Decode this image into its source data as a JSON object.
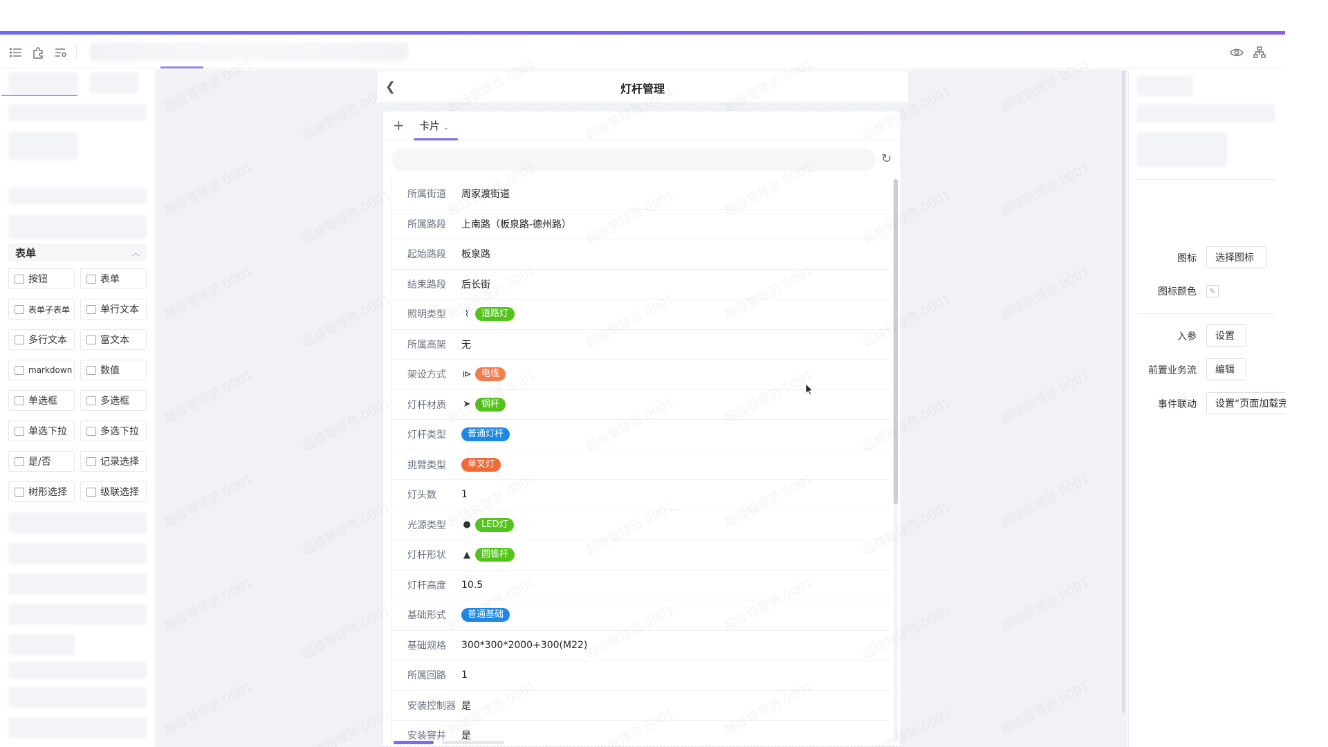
{
  "toolbar": {
    "icons": [
      "list-icon",
      "puzzle-icon",
      "settings-list-icon",
      "eye-icon",
      "sitemap-icon"
    ]
  },
  "left_panel": {
    "form_section_title": "表单",
    "components": [
      {
        "label": "按钮",
        "icon": "button-icon"
      },
      {
        "label": "表单",
        "icon": "form-icon"
      },
      {
        "label": "表单子表单",
        "icon": "subform-icon"
      },
      {
        "label": "单行文本",
        "icon": "text-icon"
      },
      {
        "label": "多行文本",
        "icon": "textarea-icon"
      },
      {
        "label": "富文本",
        "icon": "richtext-icon"
      },
      {
        "label": "markdown",
        "icon": "markdown-icon"
      },
      {
        "label": "数值",
        "icon": "number-icon"
      },
      {
        "label": "单选框",
        "icon": "radio-icon"
      },
      {
        "label": "多选框",
        "icon": "checkbox-icon"
      },
      {
        "label": "单选下拉",
        "icon": "select-icon"
      },
      {
        "label": "多选下拉",
        "icon": "multiselect-icon"
      },
      {
        "label": "是/否",
        "icon": "switch-icon"
      },
      {
        "label": "记录选择",
        "icon": "record-select-icon"
      },
      {
        "label": "树形选择",
        "icon": "tree-select-icon"
      },
      {
        "label": "级联选择",
        "icon": "cascader-icon"
      }
    ]
  },
  "page": {
    "title": "灯杆管理",
    "tab_label": "卡片",
    "rows": [
      {
        "label": "所属街道",
        "value": "周家渡街道"
      },
      {
        "label": "所属路段",
        "value": "上南路（板泉路-德州路）"
      },
      {
        "label": "起始路段",
        "value": "板泉路"
      },
      {
        "label": "结束路段",
        "value": "后长街"
      },
      {
        "label": "照明类型",
        "tag": "道路灯",
        "tag_color": "#52c41a",
        "icon": "streetlight-icon"
      },
      {
        "label": "所属高架",
        "value": "无"
      },
      {
        "label": "架设方式",
        "tag": "电缆",
        "tag_color": "#f07d4f",
        "icon": "cable-icon"
      },
      {
        "label": "灯杆材质",
        "tag": "钢杆",
        "tag_color": "#52c41a",
        "icon": "steel-icon"
      },
      {
        "label": "灯杆类型",
        "tag": "普通灯杆",
        "tag_color": "#1e88e5"
      },
      {
        "label": "挑臂类型",
        "tag": "单叉灯",
        "tag_color": "#f06a38"
      },
      {
        "label": "灯头数",
        "value": "1"
      },
      {
        "label": "光源类型",
        "tag": "LED灯",
        "tag_color": "#52c41a",
        "icon": "bulb-icon"
      },
      {
        "label": "灯杆形状",
        "tag": "圆锥杆",
        "tag_color": "#52c41a",
        "icon": "cone-icon"
      },
      {
        "label": "灯杆高度",
        "value": "10.5"
      },
      {
        "label": "基础形式",
        "tag": "普通基础",
        "tag_color": "#1e88e5"
      },
      {
        "label": "基础规格",
        "value": "300*300*2000+300(M22)"
      },
      {
        "label": "所属回路",
        "value": "1"
      },
      {
        "label": "安装控制器",
        "value": "是"
      },
      {
        "label": "安装窨井",
        "value": "是"
      }
    ]
  },
  "right_panel": {
    "icon_label": "图标",
    "icon_button": "选择图标",
    "icon_color_label": "图标颜色",
    "params_label": "入参",
    "params_button": "设置",
    "flow_label": "前置业务流",
    "flow_button": "编辑",
    "event_label": "事件联动",
    "event_button": "设置“页面加载完"
  },
  "watermark": "超级管理员 0001"
}
